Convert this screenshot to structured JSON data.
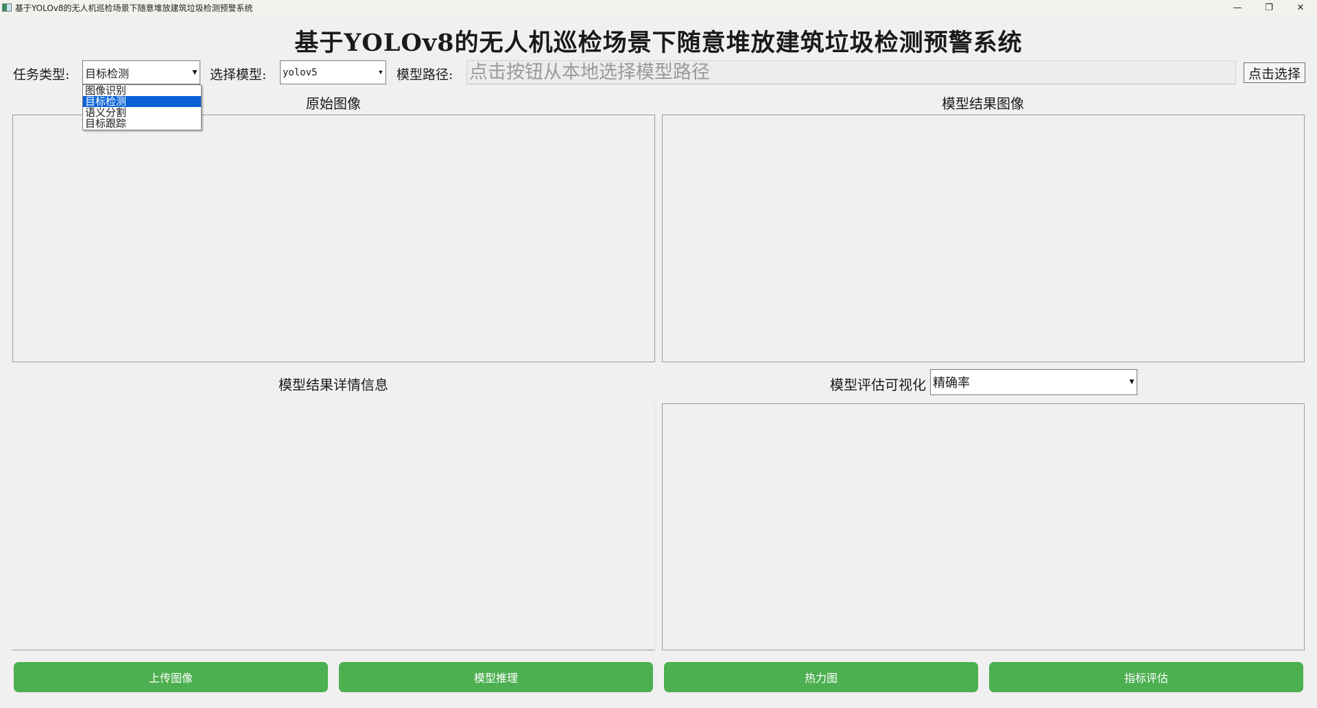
{
  "window": {
    "title": "基于YOLOv8的无人机巡检场景下随意堆放建筑垃圾检测预警系统",
    "minimize_icon": "minimize-icon",
    "maximize_icon": "restore-icon",
    "close_icon": "close-icon"
  },
  "header": {
    "title": "基于YOLOv8的无人机巡检场景下随意堆放建筑垃圾检测预警系统"
  },
  "toolbar": {
    "task_type_label": "任务类型:",
    "task_type_value": "目标检测",
    "task_type_options": [
      "图像识别",
      "目标检测",
      "语义分割",
      "目标跟踪"
    ],
    "task_type_selected_index": 1,
    "model_label": "选择模型:",
    "model_value": "yolov5",
    "model_path_label": "模型路径:",
    "model_path_placeholder": "点击按钮从本地选择模型路径",
    "choose_button": "点击选择"
  },
  "panels": {
    "original_image": "原始图像",
    "result_image": "模型结果图像",
    "result_details": "模型结果详情信息",
    "evaluation_label": "模型评估可视化",
    "evaluation_value": "精确率"
  },
  "actions": {
    "upload": "上传图像",
    "infer": "模型推理",
    "heatmap": "热力图",
    "metrics": "指标评估"
  },
  "colors": {
    "button_green": "#4caf50",
    "selection_blue": "#0a63d6",
    "background": "#f0f0f0"
  }
}
